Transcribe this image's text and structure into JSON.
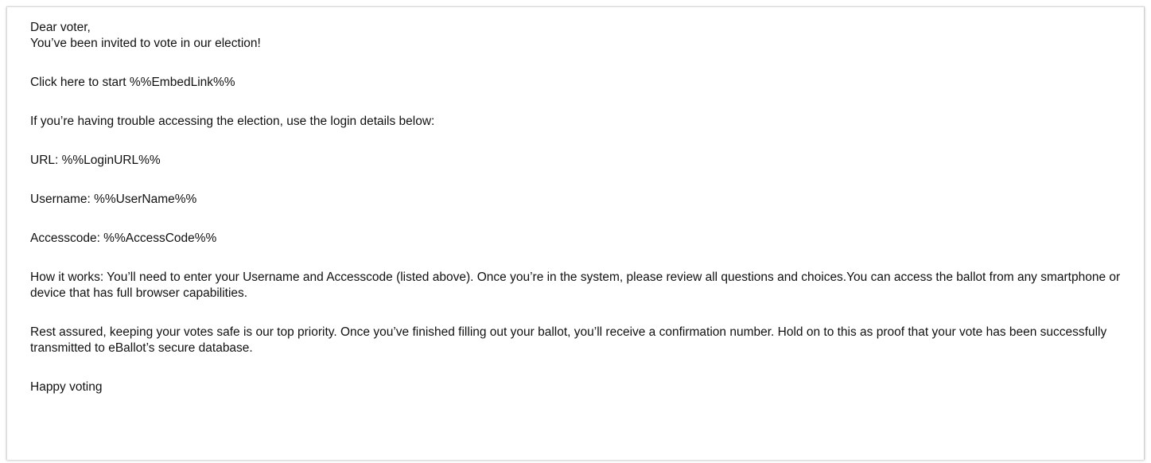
{
  "email": {
    "greeting": "Dear voter,",
    "invite": "You’ve been invited to vote in our election!",
    "start_link": "Click here to start %%EmbedLink%%",
    "trouble": "If you’re having trouble accessing the election, use the login details below:",
    "url_line": "URL: %%LoginURL%%",
    "username_line": "Username: %%UserName%%",
    "accesscode_line": "Accesscode: %%AccessCode%%",
    "how_it_works": "How it works: You’ll need to enter your Username and Accesscode (listed above). Once you’re in the system, please review all questions and choices.You can access the ballot from any smartphone or device that has full browser capabilities.",
    "rest_assured": "Rest assured, keeping your votes safe is our top priority. Once you’ve finished filling out your ballot, you’ll receive a confirmation number. Hold on to this as proof that your vote has been successfully transmitted to eBallot’s secure database.",
    "closing": "Happy voting"
  }
}
